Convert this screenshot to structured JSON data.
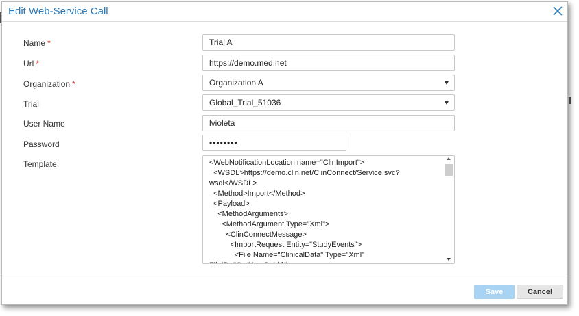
{
  "dialog": {
    "title": "Edit Web-Service Call"
  },
  "form": {
    "name": {
      "label": "Name",
      "required": "*",
      "value": "Trial A"
    },
    "url": {
      "label": "Url",
      "required": "*",
      "value": "https://demo.med.net"
    },
    "organization": {
      "label": "Organization",
      "required": "*",
      "value": "Organization A"
    },
    "trial": {
      "label": "Trial",
      "value": "Global_Trial_51036"
    },
    "username": {
      "label": "User Name",
      "value": "lvioleta"
    },
    "password": {
      "label": "Password",
      "value": "••••••••"
    },
    "template": {
      "label": "Template",
      "value": "<WebNotificationLocation name=\"ClinImport\">\n  <WSDL>https://demo.clin.net/ClinConnect/Service.svc?wsdl</WSDL>\n  <Method>Import</Method>\n  <Payload>\n    <MethodArguments>\n      <MethodArgument Type=\"Xml\">\n        <ClinConnectMessage>\n          <ImportRequest Entity=\"StudyEvents\">\n            <File Name=\"ClinicalData\" Type=\"Xml\" FileID=\"GetNewGuid()\"\nTotalPartialFiles=\"1\"\nPartialSequence=\"1\">&lt;![CDATA[<ODM"
    }
  },
  "footer": {
    "save_label": "Save",
    "cancel_label": "Cancel"
  },
  "colors": {
    "title": "#2a7ab8",
    "required": "#d9302c",
    "save_disabled": "#a9d3f2",
    "cancel": "#e6e6e6"
  }
}
